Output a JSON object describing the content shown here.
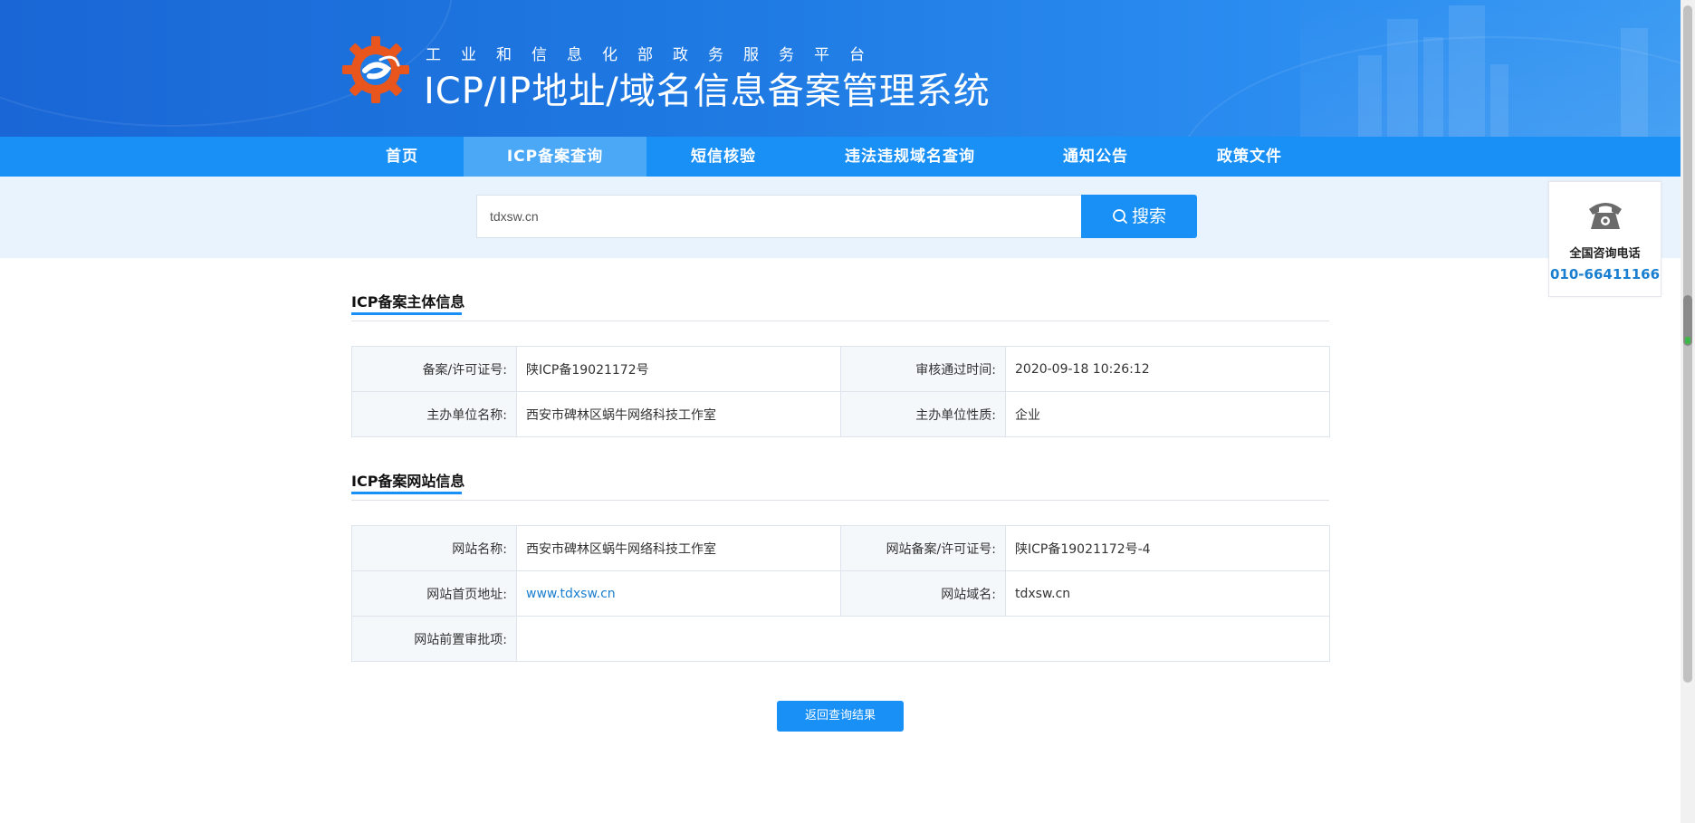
{
  "header": {
    "subtitle": "工业和信息化部政务服务平台",
    "title": "ICP/IP地址/域名信息备案管理系统",
    "logo_icon": "gear-e-logo-icon"
  },
  "nav": {
    "items": [
      {
        "label": "首页"
      },
      {
        "label": "ICP备案查询",
        "active": true
      },
      {
        "label": "短信核验"
      },
      {
        "label": "违法违规域名查询"
      },
      {
        "label": "通知公告"
      },
      {
        "label": "政策文件"
      }
    ]
  },
  "search": {
    "value": "tdxsw.cn",
    "button_label": "搜索",
    "icon": "search-icon"
  },
  "hotline": {
    "icon": "telephone-icon",
    "label": "全国咨询电话",
    "number": "010-66411166"
  },
  "entity": {
    "title": "ICP备案主体信息",
    "rows": [
      {
        "k1": "备案/许可证号:",
        "v1": "陕ICP备19021172号",
        "k2": "审核通过时间:",
        "v2": "2020-09-18 10:26:12"
      },
      {
        "k1": "主办单位名称:",
        "v1": "西安市碑林区蜗牛网络科技工作室",
        "k2": "主办单位性质:",
        "v2": "企业"
      }
    ]
  },
  "website": {
    "title": "ICP备案网站信息",
    "rows": [
      {
        "k1": "网站名称:",
        "v1": "西安市碑林区蜗牛网络科技工作室",
        "k2": "网站备案/许可证号:",
        "v2": "陕ICP备19021172号-4"
      },
      {
        "k1": "网站首页地址:",
        "v1": "www.tdxsw.cn",
        "k2": "网站域名:",
        "v2": "tdxsw.cn"
      }
    ],
    "approval_label": "网站前置审批项:",
    "approval_value": ""
  },
  "back_button": "返回查询结果",
  "colors": {
    "primary": "#1890f5",
    "banner": "#1f7be3",
    "link": "#1a7fd0"
  }
}
